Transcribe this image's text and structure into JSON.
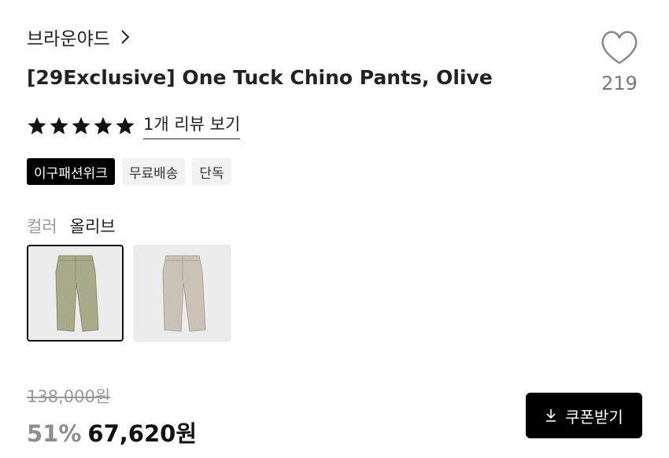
{
  "brand": {
    "name": "브라운야드",
    "chevron": "chevron-right-icon"
  },
  "product": {
    "title": "[29Exclusive] One Tuck Chino Pants, Olive"
  },
  "like": {
    "icon": "heart-icon",
    "count": "219"
  },
  "rating": {
    "stars": 5,
    "max": 5,
    "review_link": "1개 리뷰 보기"
  },
  "badges": [
    {
      "label": "이구패션위크",
      "style": "dark"
    },
    {
      "label": "무료배송",
      "style": "light"
    },
    {
      "label": "단독",
      "style": "light"
    }
  ],
  "color": {
    "label": "컬러",
    "selected": "올리브",
    "options": [
      {
        "name": "olive",
        "fill": "#a8ab8a",
        "selected": true
      },
      {
        "name": "beige",
        "fill": "#c9c2b5",
        "selected": false
      }
    ]
  },
  "price": {
    "original": "138,000원",
    "discount": "51%",
    "sale": "67,620원"
  },
  "coupon": {
    "label": "쿠폰받기",
    "icon": "download-icon"
  },
  "colors": {
    "accent": "#000000",
    "muted": "#999999"
  }
}
